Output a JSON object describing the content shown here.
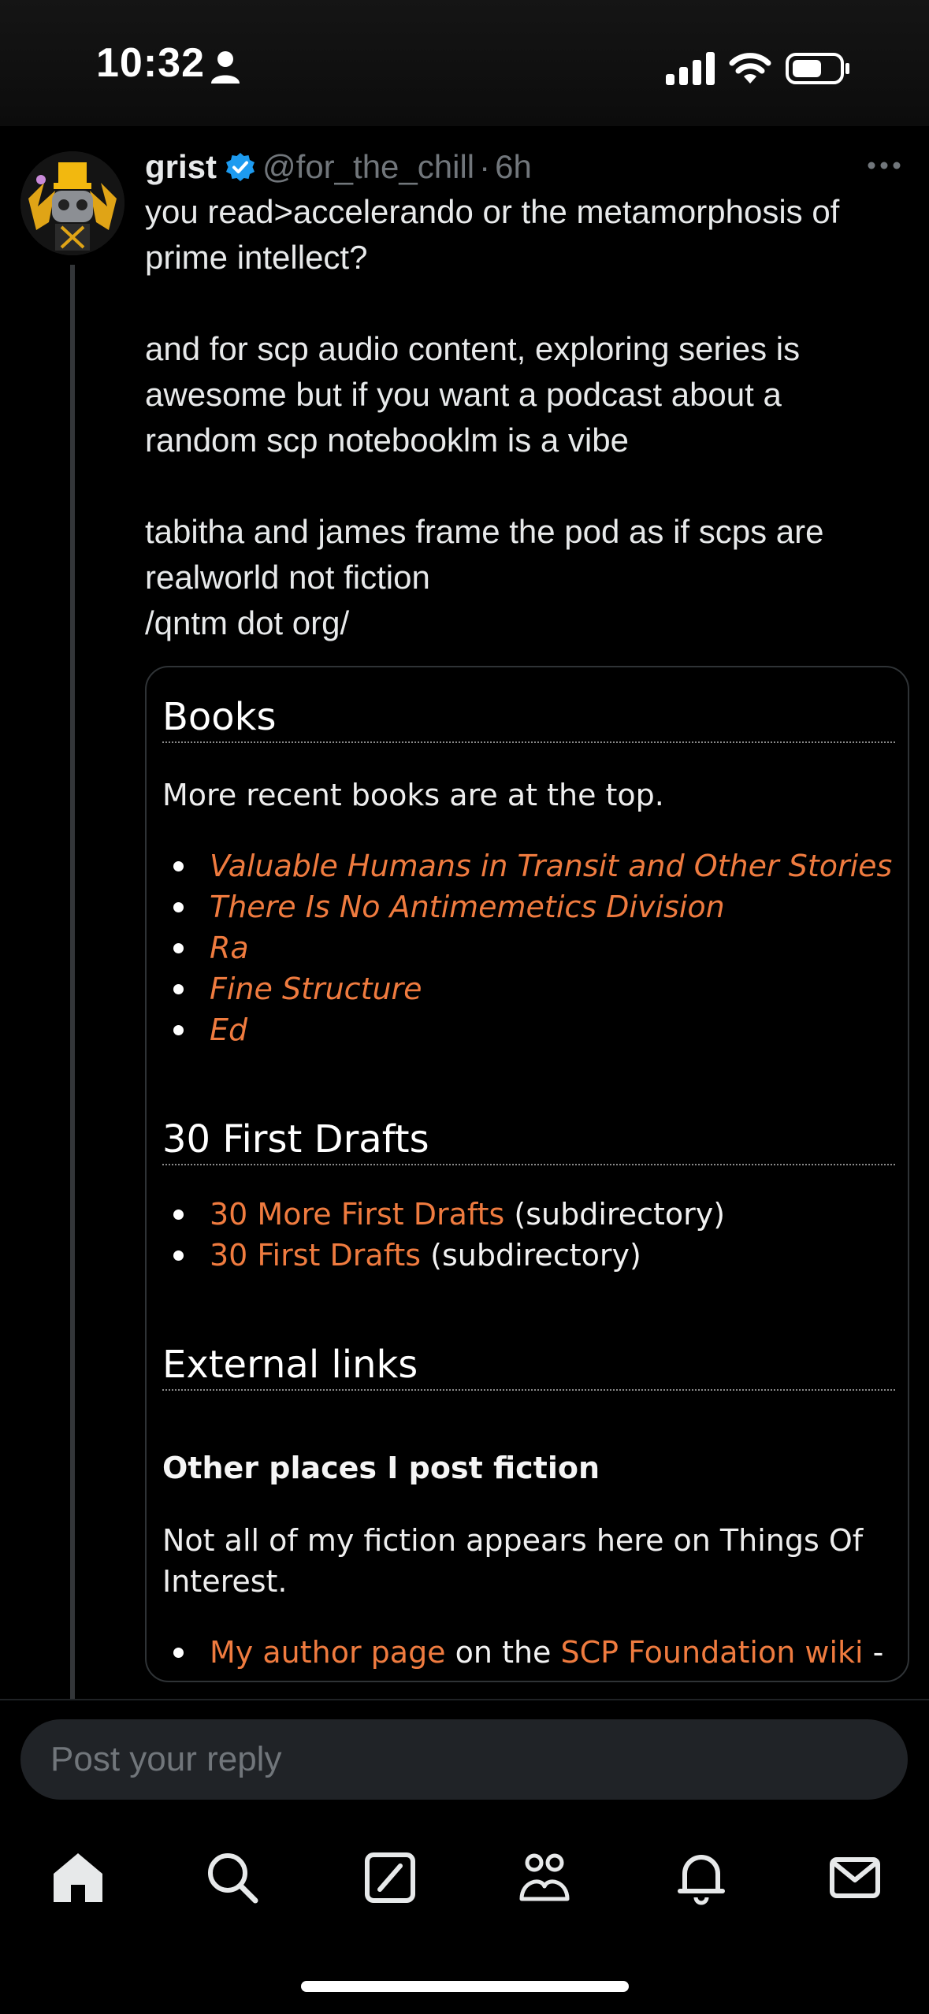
{
  "status_bar": {
    "time": "10:32"
  },
  "post": {
    "author_name": "grist",
    "handle": "@for_the_chill",
    "separator": "·",
    "age": "6h",
    "text": "you read>accelerando or the metamorphosis of prime intellect?\n\nand for scp audio content, exploring series is awesome but if you want a podcast about a random scp notebooklm is a vibe\n\ntabitha and james frame the pod as if scps are realworld not fiction\n/qntm dot org/"
  },
  "card": {
    "books_heading": "Books",
    "books_intro": "More recent books are at the top.",
    "books": [
      "Valuable Humans in Transit and Other Stories",
      "There Is No Antimemetics Division",
      "Ra",
      "Fine Structure",
      "Ed"
    ],
    "drafts_heading": "30 First Drafts",
    "drafts": [
      {
        "link": "30 More First Drafts",
        "suffix": " (subdirectory)"
      },
      {
        "link": "30 First Drafts",
        "suffix": " (subdirectory)"
      }
    ],
    "external_heading": "External links",
    "other_places_heading": "Other places I post fiction",
    "other_places_text": "Not all of my fiction appears here on Things Of Interest.",
    "author_page_link": "My author page",
    "author_page_mid": " on the ",
    "scp_wiki_link": "SCP Foundation wiki",
    "author_page_tail": " -"
  },
  "reply": {
    "placeholder": "Post your reply"
  },
  "colors": {
    "link": "#ef7b3f",
    "verified": "#1d9bf0",
    "muted": "#71767b",
    "background": "#000000"
  },
  "tabs": [
    "home-icon",
    "search-icon",
    "compose-icon",
    "communities-icon",
    "notifications-icon",
    "messages-icon"
  ]
}
